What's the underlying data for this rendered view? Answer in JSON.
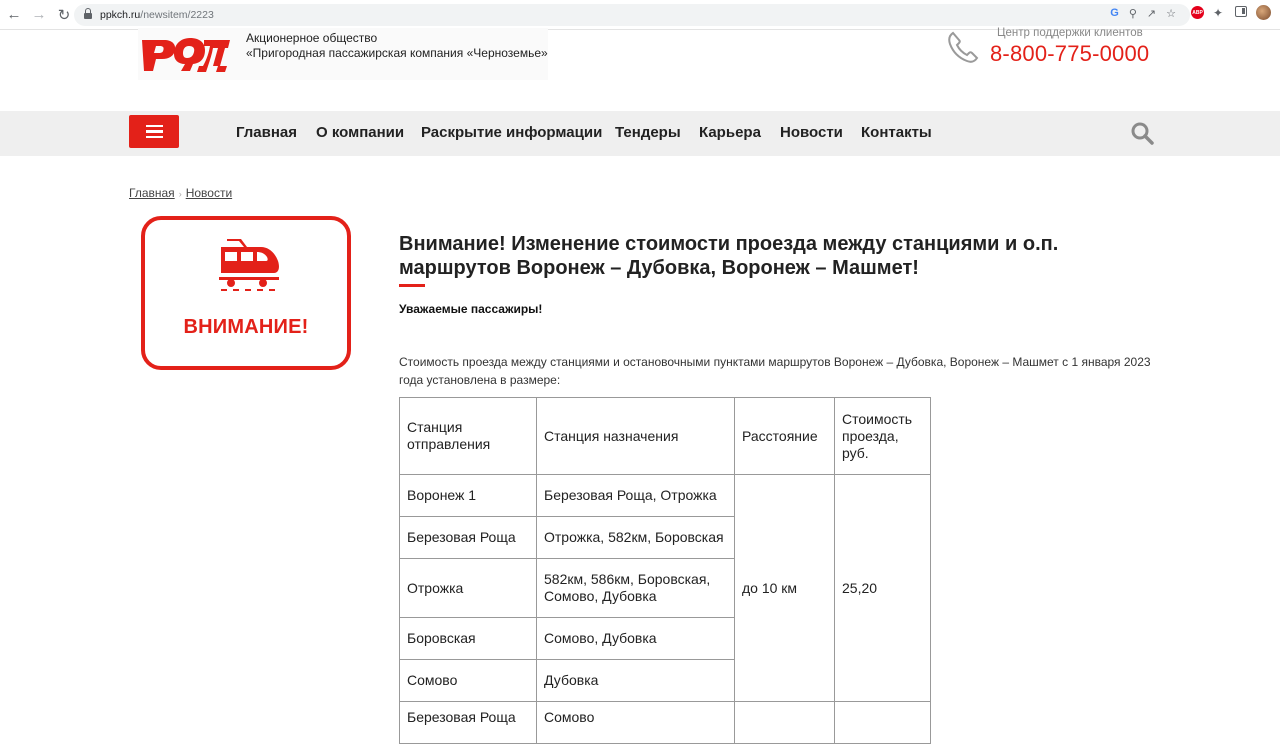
{
  "browser": {
    "url_domain": "ppkch.ru",
    "url_path": "/newsitem/2223"
  },
  "header": {
    "company_line1": "Акционерное общество",
    "company_line2": "«Пригородная пассажирская компания «Черноземье»",
    "support_label": "Центр поддержки клиентов",
    "phone": "8-800-775-0000"
  },
  "nav": {
    "items": [
      "Главная",
      "О компании",
      "Раскрытие информации",
      "Тендеры",
      "Карьера",
      "Новости",
      "Контакты"
    ]
  },
  "breadcrumb": {
    "home": "Главная",
    "current": "Новости"
  },
  "attention_card": {
    "text": "ВНИМАНИЕ!"
  },
  "article": {
    "title": "Внимание! Изменение стоимости проезда между станциями и о.п. маршрутов Воронеж – Дубовка, Воронеж – Машмет!",
    "greeting": "Уважаемые пассажиры!",
    "intro": "Стоимость проезда между станциями и остановочными пунктами маршрутов Воронеж – Дубовка, Воронеж – Машмет с 1 января 2023 года установлена в размере:"
  },
  "fare_table": {
    "headers": [
      "Станция отправления",
      "Станция назначения",
      "Расстояние",
      "Стоимость проезда, руб."
    ],
    "rows": [
      {
        "from": "Воронеж 1",
        "to": "Березовая Роща, Отрожка"
      },
      {
        "from": "Березовая Роща",
        "to": "Отрожка, 582км, Боровская"
      },
      {
        "from": "Отрожка",
        "to": "582км, 586км, Боровская, Сомово, Дубовка"
      },
      {
        "from": "Боровская",
        "to": "Сомово, Дубовка"
      },
      {
        "from": "Сомово",
        "to": "Дубовка"
      },
      {
        "from": "Березовая Роща",
        "to": "Сомово"
      }
    ],
    "distance": "до 10 км",
    "price": "25,20"
  },
  "colors": {
    "brand_red": "#e32119",
    "nav_bg": "#efefef"
  }
}
